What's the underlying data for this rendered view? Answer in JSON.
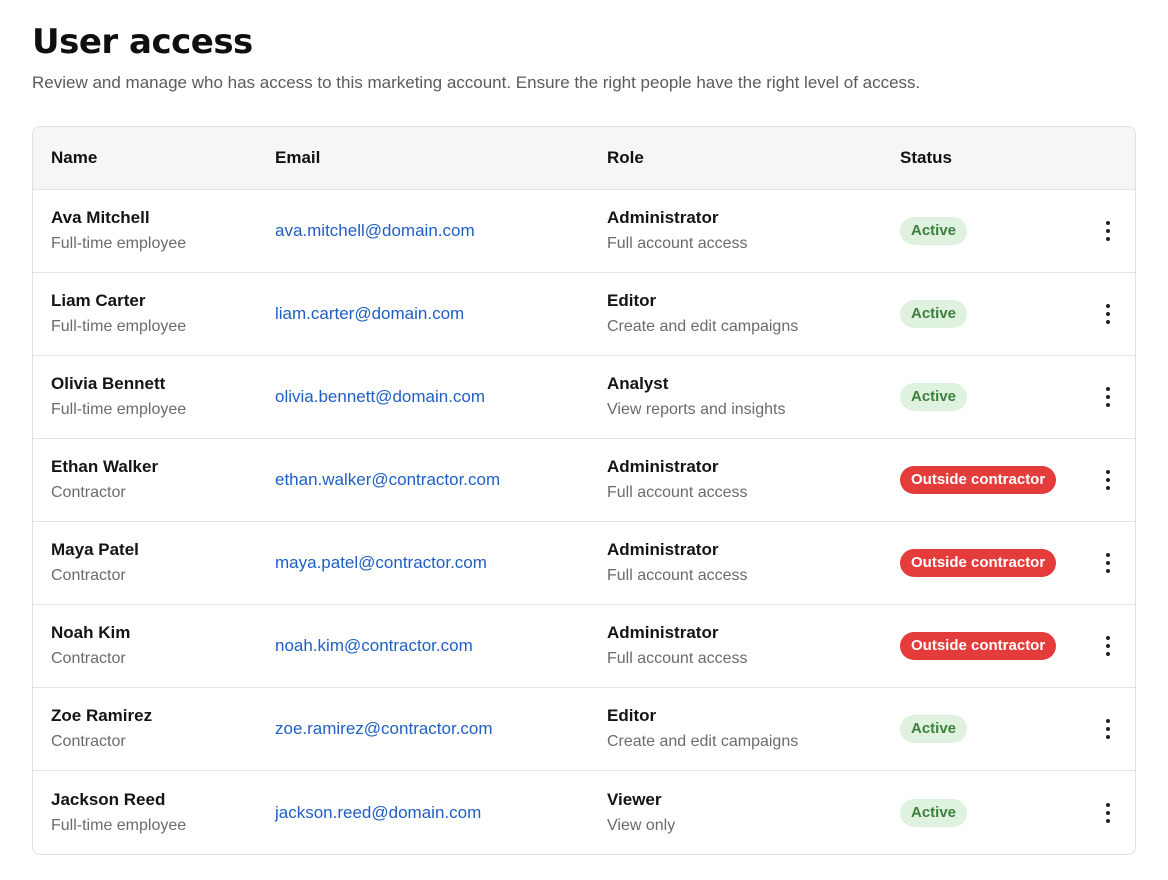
{
  "header": {
    "title": "User access",
    "subtitle": "Review and manage who has access to this marketing account. Ensure the right people have the right level of access."
  },
  "table": {
    "columns": [
      "Name",
      "Email",
      "Role",
      "Status"
    ],
    "rows": [
      {
        "name": "Ava Mitchell",
        "type": "Full-time employee",
        "email": "ava.mitchell@domain.com",
        "role": "Administrator",
        "role_desc": "Full account access",
        "status": "Active"
      },
      {
        "name": "Liam Carter",
        "type": "Full-time employee",
        "email": "liam.carter@domain.com",
        "role": "Editor",
        "role_desc": "Create and edit campaigns",
        "status": "Active"
      },
      {
        "name": "Olivia Bennett",
        "type": "Full-time employee",
        "email": "olivia.bennett@domain.com",
        "role": "Analyst",
        "role_desc": "View reports and insights",
        "status": "Active"
      },
      {
        "name": "Ethan Walker",
        "type": "Contractor",
        "email": "ethan.walker@contractor.com",
        "role": "Administrator",
        "role_desc": "Full account access",
        "status": "Outside contractor"
      },
      {
        "name": "Maya Patel",
        "type": "Contractor",
        "email": "maya.patel@contractor.com",
        "role": "Administrator",
        "role_desc": "Full account access",
        "status": "Outside contractor"
      },
      {
        "name": "Noah Kim",
        "type": "Contractor",
        "email": "noah.kim@contractor.com",
        "role": "Administrator",
        "role_desc": "Full account access",
        "status": "Outside contractor"
      },
      {
        "name": "Zoe Ramirez",
        "type": "Contractor",
        "email": "zoe.ramirez@contractor.com",
        "role": "Editor",
        "role_desc": "Create and edit campaigns",
        "status": "Active"
      },
      {
        "name": "Jackson Reed",
        "type": "Full-time employee",
        "email": "jackson.reed@domain.com",
        "role": "Viewer",
        "role_desc": "View only",
        "status": "Active"
      }
    ]
  },
  "icons": {
    "row_actions": "more-vertical-icon"
  },
  "colors": {
    "link": "#1f5fc4",
    "active_bg": "#dff1df",
    "active_text": "#3e7f3e",
    "contractor_bg": "#e43b3b",
    "contractor_text": "#ffffff"
  }
}
